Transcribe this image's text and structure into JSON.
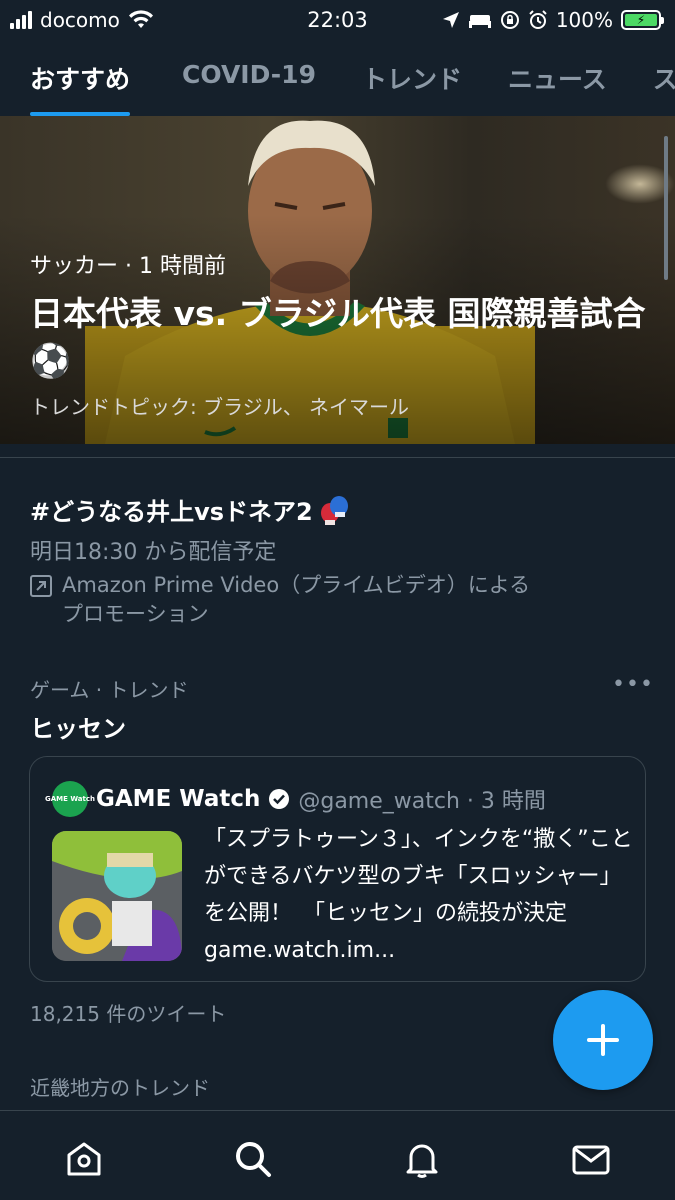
{
  "status_bar": {
    "carrier": "docomo",
    "time": "22:03",
    "battery": "100%"
  },
  "tabs": [
    {
      "label": "おすすめ",
      "active": true
    },
    {
      "label": "COVID-19",
      "active": false
    },
    {
      "label": "トレンド",
      "active": false
    },
    {
      "label": "ニュース",
      "active": false
    },
    {
      "label": "スポ",
      "active": false
    }
  ],
  "hero": {
    "meta": "サッカー · 1 時間前",
    "title": "日本代表 vs. ブラジル代表 国際親善試合⚽",
    "subtitle": "トレンドトピック: ブラジル、 ネイマール"
  },
  "promo": {
    "title": "#どうなる井上vsドネア2",
    "schedule": "明日18:30 から配信予定",
    "promoted_by": "Amazon Prime Video（プライムビデオ）による",
    "promoted_suffix": "プロモーション"
  },
  "trend": {
    "category": "ゲーム · トレンド",
    "name": "ヒッセン",
    "more_label": "•••",
    "tweet": {
      "avatar_text": "GAME Watch",
      "author": "GAME Watch",
      "handle": "@game_watch · 3 時間",
      "text": "「スプラトゥーン３」、インクを“撒く”ことができるバケツ型のブキ「スロッシャー」を公開！　「ヒッセン」の続投が決定 game.watch.im..."
    },
    "tweet_count": "18,215 件のツイート"
  },
  "next_section": {
    "title": "近畿地方のトレンド"
  },
  "fab": {
    "icon": "plus-icon"
  },
  "bottom_nav": [
    {
      "icon": "home-icon"
    },
    {
      "icon": "search-icon"
    },
    {
      "icon": "bell-icon"
    },
    {
      "icon": "mail-icon"
    }
  ],
  "colors": {
    "background": "#15202b",
    "accent": "#1d9bf0",
    "secondary_text": "#8b98a5",
    "divider": "#38444d"
  }
}
